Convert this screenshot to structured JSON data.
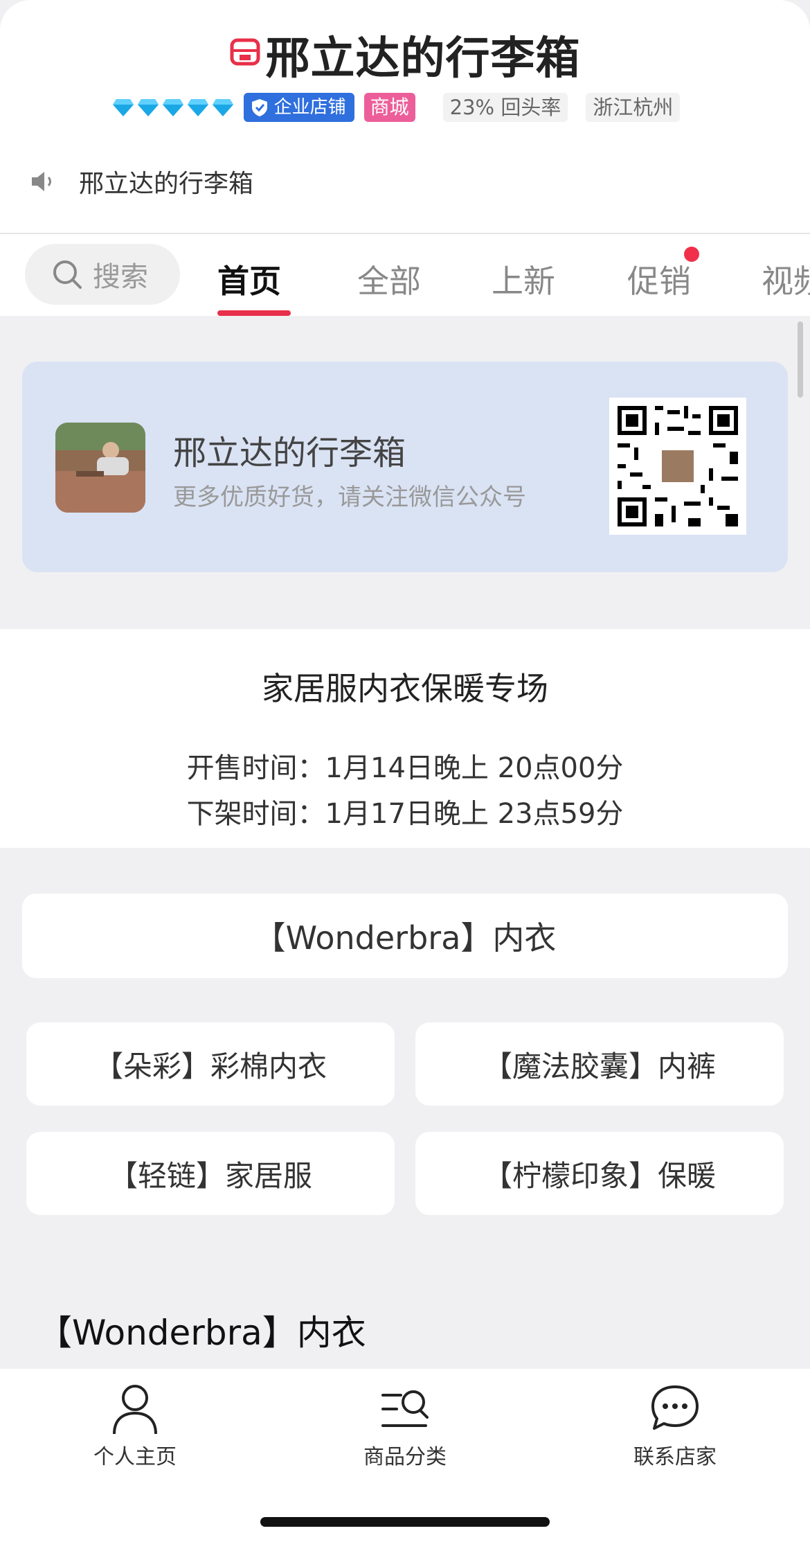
{
  "header": {
    "shop_name": "邢立达的行李箱",
    "diamond_count": 5,
    "badge_enterprise": "企业店铺",
    "badge_mall": "商城",
    "repurchase_rate": "23% 回头率",
    "location": "浙江杭州",
    "notice": "邢立达的行李箱",
    "colors": {
      "enterprise_badge": "#2f6fde",
      "mall_badge": "#ec5e9a",
      "diamond": "#1aa7e6"
    }
  },
  "tabs": {
    "search_placeholder": "搜索",
    "items": [
      {
        "label": "首页",
        "active": true
      },
      {
        "label": "全部",
        "active": false
      },
      {
        "label": "上新",
        "active": false
      },
      {
        "label": "促销",
        "active": false,
        "dot": true
      },
      {
        "label": "视频",
        "active": false
      }
    ],
    "accent": "#e8304a"
  },
  "wechat_card": {
    "name": "邢立达的行李箱",
    "subtitle": "更多优质好货，请关注微信公众号",
    "icons": [
      "avatar-photo",
      "qr-code"
    ]
  },
  "promo": {
    "title": "家居服内衣保暖专场",
    "sale_start": "开售时间：1月14日晚上 20点00分",
    "sale_end": "下架时间：1月17日晚上 23点59分"
  },
  "categories": {
    "featured": "【Wonderbra】内衣",
    "items": [
      "【朵彩】彩棉内衣",
      "【魔法胶囊】内裤",
      "【轻链】家居服",
      "【柠檬印象】保暖"
    ]
  },
  "section_title": "【Wonderbra】内衣",
  "bottom_nav": [
    {
      "label": "个人主页",
      "icon": "person-icon"
    },
    {
      "label": "商品分类",
      "icon": "category-search-icon"
    },
    {
      "label": "联系店家",
      "icon": "chat-icon"
    }
  ]
}
